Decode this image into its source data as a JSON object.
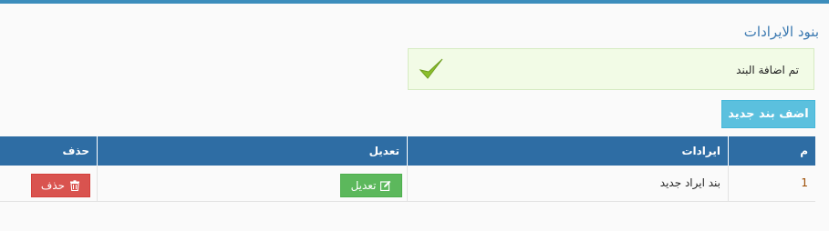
{
  "page": {
    "title": "بنود الايرادات"
  },
  "alert": {
    "message": "تم اضافة البند",
    "icon": "check-icon",
    "color": "#8bbf2c"
  },
  "toolbar": {
    "add_label": "اضف بند جديد"
  },
  "table": {
    "headers": {
      "number": "م",
      "revenues": "ايرادات",
      "edit": "تعديل",
      "delete": "حذف"
    },
    "rows": [
      {
        "number": "1",
        "name": "بند ايراد جديد",
        "edit_label": "تعديل",
        "edit_icon": "edit-icon",
        "delete_label": "حذف",
        "delete_icon": "trash-icon"
      }
    ]
  },
  "colors": {
    "header": "#2e6da4",
    "info_button": "#5bc0de",
    "success_button": "#5cb85c",
    "danger_button": "#d9534f"
  }
}
